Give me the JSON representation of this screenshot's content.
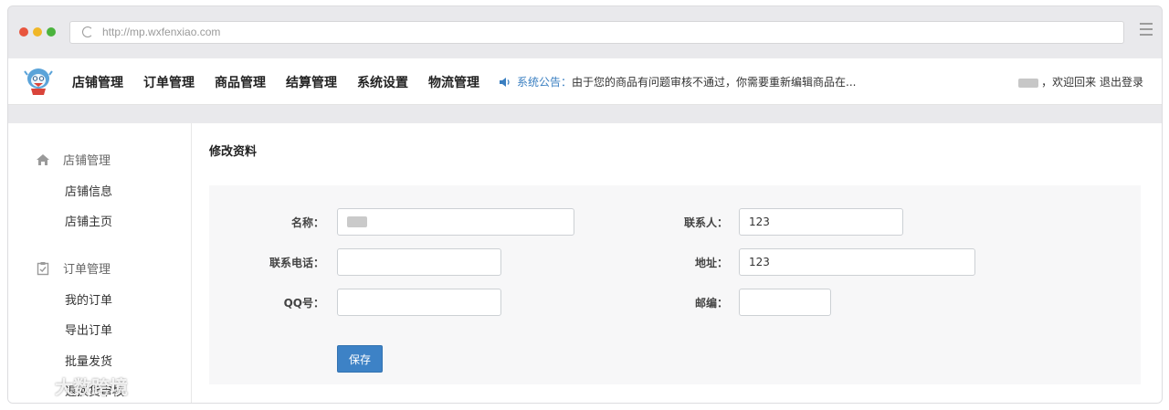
{
  "browser": {
    "url": "http://mp.wxfenxiao.com",
    "traffic_light_colors": [
      "#e8553e",
      "#f0b728",
      "#4bb33d"
    ]
  },
  "header": {
    "nav": [
      "店铺管理",
      "订单管理",
      "商品管理",
      "结算管理",
      "系统设置",
      "物流管理"
    ],
    "notice_label": "系统公告：",
    "notice_text": "由于您的商品有问题审核不通过，你需要重新编辑商品在...",
    "welcome": "，欢迎回来",
    "logout": "退出登录"
  },
  "sidebar": {
    "groups": [
      {
        "label": "店铺管理",
        "icon": "home-icon",
        "items": [
          "店铺信息",
          "店铺主页"
        ]
      },
      {
        "label": "订单管理",
        "icon": "clipboard-check-icon",
        "items": [
          "我的订单",
          "导出订单",
          "批量发货",
          "退换货审核"
        ]
      }
    ]
  },
  "main": {
    "title": "修改资料",
    "fields": {
      "name_label": "名称：",
      "contact_label": "联系人：",
      "contact_value": "123",
      "phone_label": "联系电话：",
      "phone_value": "",
      "address_label": "地址：",
      "address_value": "123",
      "qq_label": "QQ号：",
      "qq_value": "",
      "zip_label": "邮编：",
      "zip_value": ""
    },
    "save_label": "保存"
  },
  "watermark": "大数跨境",
  "colors": {
    "accent": "#3d82c6",
    "notice": "#3a7fc1"
  }
}
